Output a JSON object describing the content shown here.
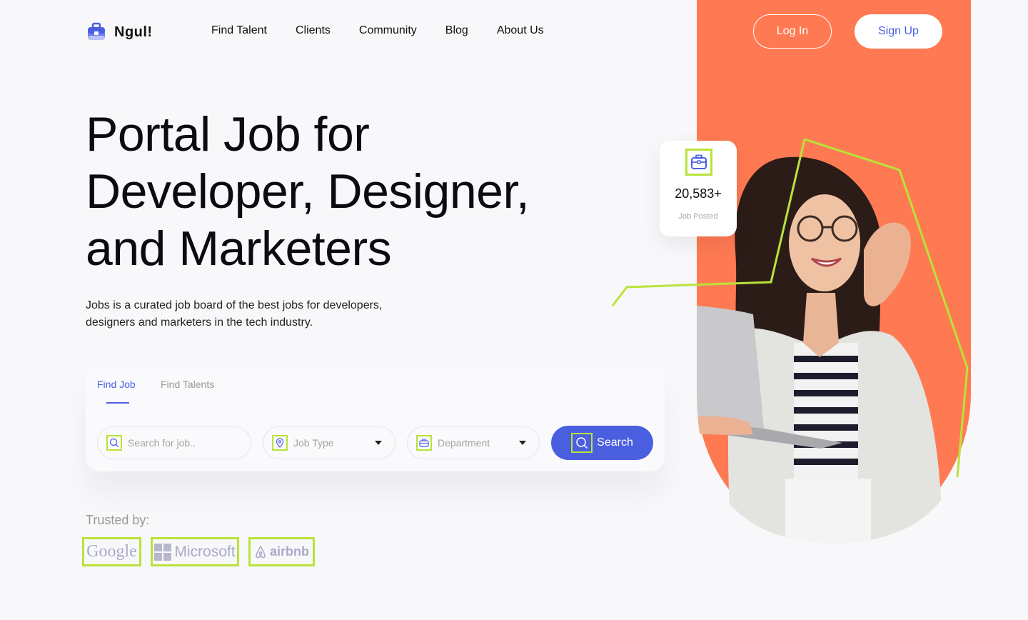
{
  "header": {
    "logo_text": "Ngul!",
    "nav": [
      "Find Talent",
      "Clients",
      "Community",
      "Blog",
      "About Us"
    ],
    "login_label": "Log In",
    "signup_label": "Sign Up"
  },
  "hero": {
    "headline_lines": [
      "Portal Job for",
      "Developer, Designer,",
      "and Marketers"
    ],
    "subtext": "Jobs is a curated job board of the best jobs for developers, designers and marketers in the tech industry."
  },
  "search": {
    "tabs": [
      "Find Job",
      "Find Talents"
    ],
    "active_tab": "Find Job",
    "query_placeholder": "Search for job..",
    "job_type_label": "Job Type",
    "department_label": "Department",
    "button_label": "Search"
  },
  "trusted": {
    "label": "Trusted by:",
    "brands": [
      "Google",
      "Microsoft",
      "airbnb"
    ]
  },
  "stat": {
    "value": "20,583+",
    "label": "Job Posted",
    "icon": "briefcase-icon"
  },
  "colors": {
    "accent": "#4a5ee0",
    "hero_panel": "#ff7a52",
    "highlight": "#b9e33a"
  }
}
